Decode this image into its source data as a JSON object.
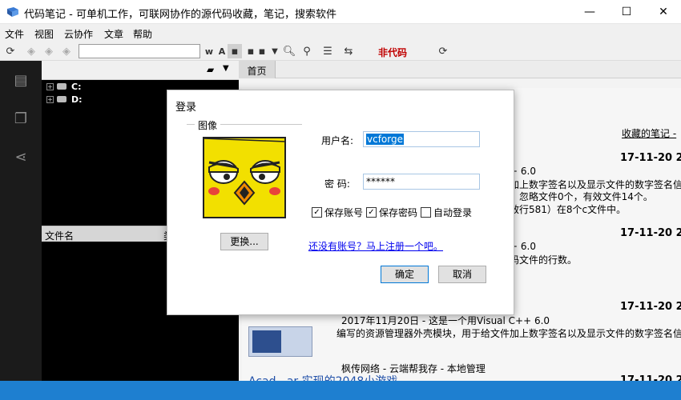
{
  "window": {
    "title": "代码笔记 - 可单机工作，可联网协作的源代码收藏，笔记，搜索软件",
    "min_glyph": "—",
    "max_glyph": "☐",
    "close_glyph": "✕"
  },
  "menu": [
    "文件",
    "视图",
    "云协作",
    "文章",
    "帮助"
  ],
  "toolbar": {
    "noncode_label": "非代码",
    "search_value": "",
    "word_btn": "w",
    "text_btn": "A"
  },
  "tree": {
    "drives": [
      "C:",
      "D:"
    ],
    "columns": [
      "文件名",
      "类"
    ]
  },
  "content": {
    "tab_home": "首页",
    "favorites_link": "收藏的笔记 -",
    "entries": [
      {
        "date": "17-11-20 2",
        "line1": "+ 6.0",
        "line2": "加上数字签名以及显示文件的数字签名信",
        "line3": "，忽略文件0个，有效文件14个。",
        "line4": "效行581）在8个c文件中。"
      },
      {
        "date": "17-11-20 2",
        "line1": "+ 6.0",
        "line2": "码文件的行数。"
      },
      {
        "date": "17-11-20 2",
        "line1": "2017年11月20日 - 这是一个用Visual C++ 6.0",
        "line2": "编写的资源管理器外壳模块，用于给文件加上数字签名以及显示文件的数字签名信",
        "line3": "枫传网络 - 云端帮我存 - 本地管理"
      },
      {
        "date": "17-11-20 2",
        "line1": "Acad...ar 实现的2048小游戏"
      }
    ]
  },
  "dialog": {
    "title": "登录",
    "group_label": "图像",
    "change_button": "更换...",
    "username_label": "用户名:",
    "username_value": "vcforge",
    "password_label": "密  码:",
    "password_value": "******",
    "save_account": "保存账号",
    "save_password": "保存密码",
    "auto_login": "自动登录",
    "save_account_checked": true,
    "save_password_checked": true,
    "auto_login_checked": false,
    "register_link": "还没有账号？马上注册一个吧。",
    "ok_button": "确定",
    "cancel_button": "取消"
  },
  "colors": {
    "accent": "#1e7fd0",
    "noncode": "#c00000",
    "avatar_yellow": "#f2e000"
  }
}
